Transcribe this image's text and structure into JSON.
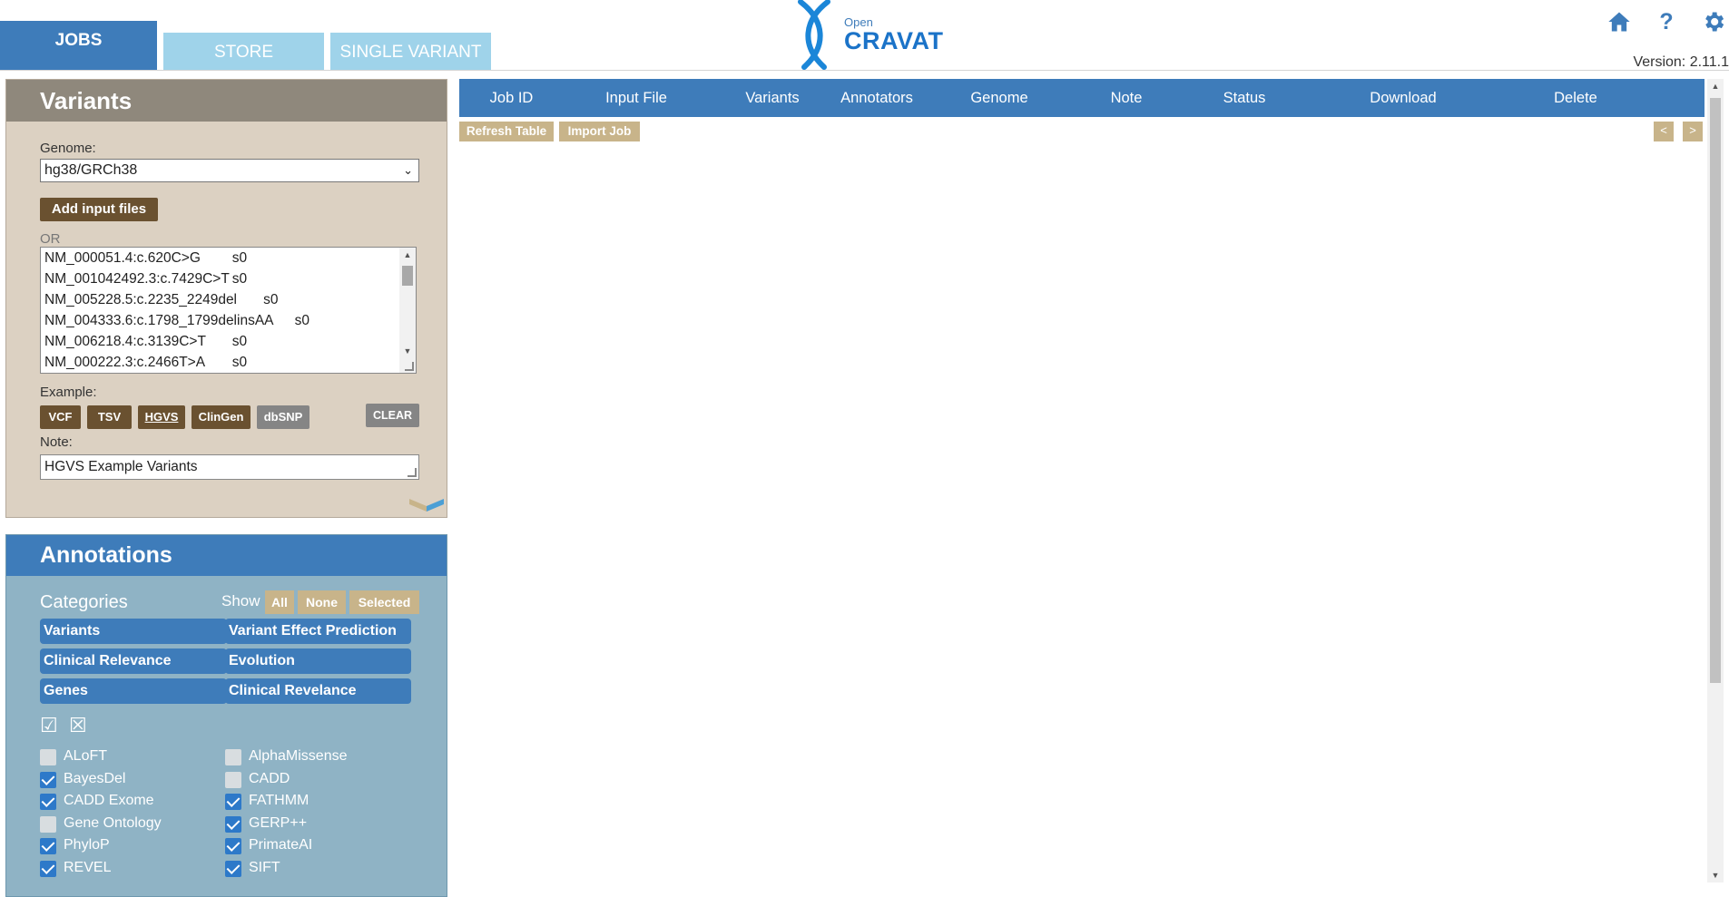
{
  "tabs": {
    "jobs": "JOBS",
    "store": "STORE",
    "single_variant": "SINGLE VARIANT"
  },
  "logo": {
    "small": "Open",
    "big": "CRAVAT"
  },
  "header_icons": {
    "home": "home-icon",
    "help": "?",
    "settings": "gear-icon"
  },
  "version": "Version: 2.11.1",
  "variants_panel": {
    "title": "Variants",
    "genome_label": "Genome:",
    "genome_selected": "hg38/GRCh38",
    "add_files": "Add input files",
    "or_label": "OR",
    "input_lines": [
      "NM_000051.4:c.620C>G\ts0",
      "NM_001042492.3:c.7429C>T\ts0",
      "NM_005228.5:c.2235_2249del\ts0",
      "NM_004333.6:c.1798_1799delinsAA\ts0",
      "NM_006218.4:c.3139C>T\ts0",
      "NM_000222.3:c.2466T>A\ts0"
    ],
    "example_label": "Example:",
    "examples": {
      "vcf": "VCF",
      "tsv": "TSV",
      "hgvs": "HGVS",
      "clingen": "ClinGen",
      "dbsnp": "dbSNP"
    },
    "clear": "CLEAR",
    "note_label": "Note:",
    "note_value": "HGVS Example Variants"
  },
  "annotations_panel": {
    "title": "Annotations",
    "categories_label": "Categories",
    "show_label": "Show",
    "show_all": "All",
    "show_none": "None",
    "show_selected": "Selected",
    "categories": [
      "Variants",
      "Variant Effect Prediction",
      "Clinical Relevance",
      "Evolution",
      "Genes",
      "Clinical Revelance"
    ],
    "select_all_glyph": "☑",
    "select_none_glyph": "☒",
    "modules": [
      {
        "label": "ALoFT",
        "checked": false
      },
      {
        "label": "AlphaMissense",
        "checked": false
      },
      {
        "label": "BayesDel",
        "checked": true
      },
      {
        "label": "CADD",
        "checked": false
      },
      {
        "label": "CADD Exome",
        "checked": true
      },
      {
        "label": "FATHMM",
        "checked": true
      },
      {
        "label": "Gene Ontology",
        "checked": false
      },
      {
        "label": "GERP++",
        "checked": true
      },
      {
        "label": "PhyloP",
        "checked": true
      },
      {
        "label": "PrimateAI",
        "checked": true
      },
      {
        "label": "REVEL",
        "checked": true
      },
      {
        "label": "SIFT",
        "checked": true
      }
    ]
  },
  "jobs_table": {
    "columns": [
      "Job ID",
      "Input File",
      "Variants",
      "Annotators",
      "Genome",
      "Note",
      "Status",
      "Download",
      "Delete"
    ],
    "refresh": "Refresh Table",
    "import": "Import Job",
    "prev": "<",
    "next": ">"
  }
}
